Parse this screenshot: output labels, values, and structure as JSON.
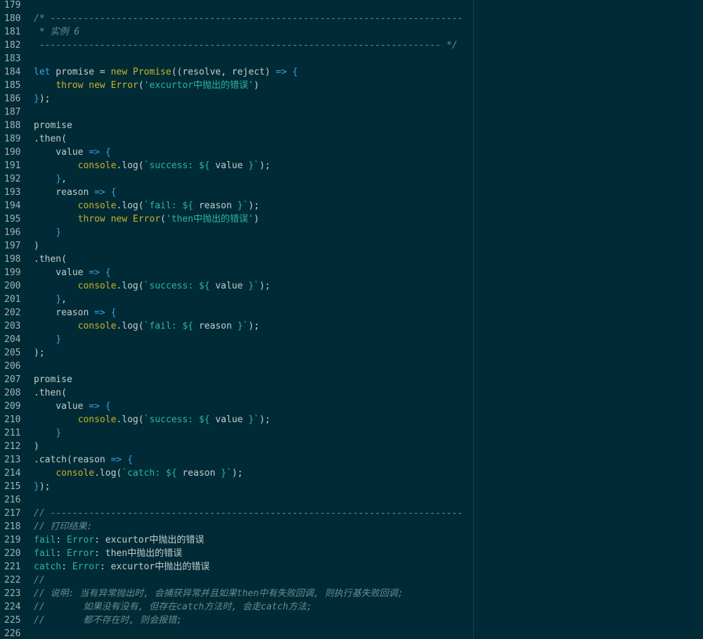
{
  "editor": {
    "theme": {
      "background": "#002b36",
      "line_number_color": "#a4b2b2",
      "text_color": "#c3cdcd",
      "keyword_color": "#3aa0e0",
      "function_color": "#c6b12e",
      "string_color": "#2eb3a5",
      "comment_color": "#6a8a91"
    },
    "lines": [
      {
        "n": "179",
        "tokens": []
      },
      {
        "n": "180",
        "tokens": [
          {
            "t": "/* ---------------------------------------------------------------------------",
            "c": "com"
          }
        ]
      },
      {
        "n": "181",
        "tokens": [
          {
            "t": " * 实例 6",
            "c": "com"
          }
        ]
      },
      {
        "n": "182",
        "tokens": [
          {
            "t": " ------------------------------------------------------------------------- */",
            "c": "com"
          }
        ]
      },
      {
        "n": "183",
        "tokens": []
      },
      {
        "n": "184",
        "tokens": [
          {
            "t": "let",
            "c": "kw"
          },
          {
            "t": " promise = ",
            "c": "text"
          },
          {
            "t": "new",
            "c": "kw2"
          },
          {
            "t": " ",
            "c": "text"
          },
          {
            "t": "Promise",
            "c": "cls"
          },
          {
            "t": "((resolve, reject) ",
            "c": "text"
          },
          {
            "t": "=>",
            "c": "op"
          },
          {
            "t": " ",
            "c": "text"
          },
          {
            "t": "{",
            "c": "pun"
          }
        ]
      },
      {
        "n": "185",
        "tokens": [
          {
            "t": "    ",
            "c": "text"
          },
          {
            "t": "throw",
            "c": "kw2"
          },
          {
            "t": " ",
            "c": "text"
          },
          {
            "t": "new",
            "c": "kw2"
          },
          {
            "t": " ",
            "c": "text"
          },
          {
            "t": "Error",
            "c": "cls"
          },
          {
            "t": "(",
            "c": "text"
          },
          {
            "t": "'excurtor中抛出的错误'",
            "c": "str"
          },
          {
            "t": ")",
            "c": "text"
          }
        ]
      },
      {
        "n": "186",
        "tokens": [
          {
            "t": "}",
            "c": "pun"
          },
          {
            "t": ");",
            "c": "text"
          }
        ]
      },
      {
        "n": "187",
        "tokens": []
      },
      {
        "n": "188",
        "tokens": [
          {
            "t": "promise",
            "c": "text"
          }
        ]
      },
      {
        "n": "189",
        "tokens": [
          {
            "t": ".then(",
            "c": "text"
          }
        ]
      },
      {
        "n": "190",
        "tokens": [
          {
            "t": "    value ",
            "c": "text"
          },
          {
            "t": "=>",
            "c": "op"
          },
          {
            "t": " ",
            "c": "text"
          },
          {
            "t": "{",
            "c": "pun"
          }
        ]
      },
      {
        "n": "191",
        "tokens": [
          {
            "t": "        ",
            "c": "text"
          },
          {
            "t": "console",
            "c": "fn"
          },
          {
            "t": ".log(",
            "c": "text"
          },
          {
            "t": "`success: ${",
            "c": "str"
          },
          {
            "t": " value ",
            "c": "text"
          },
          {
            "t": "}`",
            "c": "str"
          },
          {
            "t": ");",
            "c": "text"
          }
        ]
      },
      {
        "n": "192",
        "tokens": [
          {
            "t": "    ",
            "c": "text"
          },
          {
            "t": "}",
            "c": "pun"
          },
          {
            "t": ",",
            "c": "text"
          }
        ]
      },
      {
        "n": "193",
        "tokens": [
          {
            "t": "    reason ",
            "c": "text"
          },
          {
            "t": "=>",
            "c": "op"
          },
          {
            "t": " ",
            "c": "text"
          },
          {
            "t": "{",
            "c": "pun"
          }
        ]
      },
      {
        "n": "194",
        "tokens": [
          {
            "t": "        ",
            "c": "text"
          },
          {
            "t": "console",
            "c": "fn"
          },
          {
            "t": ".log(",
            "c": "text"
          },
          {
            "t": "`fail: ${",
            "c": "str"
          },
          {
            "t": " reason ",
            "c": "text"
          },
          {
            "t": "}`",
            "c": "str"
          },
          {
            "t": ");",
            "c": "text"
          }
        ]
      },
      {
        "n": "195",
        "tokens": [
          {
            "t": "        ",
            "c": "text"
          },
          {
            "t": "throw",
            "c": "kw2"
          },
          {
            "t": " ",
            "c": "text"
          },
          {
            "t": "new",
            "c": "kw2"
          },
          {
            "t": " ",
            "c": "text"
          },
          {
            "t": "Error",
            "c": "cls"
          },
          {
            "t": "(",
            "c": "text"
          },
          {
            "t": "'then中抛出的错误'",
            "c": "str"
          },
          {
            "t": ")",
            "c": "text"
          }
        ]
      },
      {
        "n": "196",
        "tokens": [
          {
            "t": "    ",
            "c": "text"
          },
          {
            "t": "}",
            "c": "pun"
          }
        ]
      },
      {
        "n": "197",
        "tokens": [
          {
            "t": ")",
            "c": "text"
          }
        ]
      },
      {
        "n": "198",
        "tokens": [
          {
            "t": ".then(",
            "c": "text"
          }
        ]
      },
      {
        "n": "199",
        "tokens": [
          {
            "t": "    value ",
            "c": "text"
          },
          {
            "t": "=>",
            "c": "op"
          },
          {
            "t": " ",
            "c": "text"
          },
          {
            "t": "{",
            "c": "pun"
          }
        ]
      },
      {
        "n": "200",
        "tokens": [
          {
            "t": "        ",
            "c": "text"
          },
          {
            "t": "console",
            "c": "fn"
          },
          {
            "t": ".log(",
            "c": "text"
          },
          {
            "t": "`success: ${",
            "c": "str"
          },
          {
            "t": " value ",
            "c": "text"
          },
          {
            "t": "}`",
            "c": "str"
          },
          {
            "t": ");",
            "c": "text"
          }
        ]
      },
      {
        "n": "201",
        "tokens": [
          {
            "t": "    ",
            "c": "text"
          },
          {
            "t": "}",
            "c": "pun"
          },
          {
            "t": ",",
            "c": "text"
          }
        ]
      },
      {
        "n": "202",
        "tokens": [
          {
            "t": "    reason ",
            "c": "text"
          },
          {
            "t": "=>",
            "c": "op"
          },
          {
            "t": " ",
            "c": "text"
          },
          {
            "t": "{",
            "c": "pun"
          }
        ]
      },
      {
        "n": "203",
        "tokens": [
          {
            "t": "        ",
            "c": "text"
          },
          {
            "t": "console",
            "c": "fn"
          },
          {
            "t": ".log(",
            "c": "text"
          },
          {
            "t": "`fail: ${",
            "c": "str"
          },
          {
            "t": " reason ",
            "c": "text"
          },
          {
            "t": "}`",
            "c": "str"
          },
          {
            "t": ");",
            "c": "text"
          }
        ]
      },
      {
        "n": "204",
        "tokens": [
          {
            "t": "    ",
            "c": "text"
          },
          {
            "t": "}",
            "c": "pun"
          }
        ]
      },
      {
        "n": "205",
        "tokens": [
          {
            "t": ");",
            "c": "text"
          }
        ]
      },
      {
        "n": "206",
        "tokens": []
      },
      {
        "n": "207",
        "tokens": [
          {
            "t": "promise",
            "c": "text"
          }
        ]
      },
      {
        "n": "208",
        "tokens": [
          {
            "t": ".then(",
            "c": "text"
          }
        ]
      },
      {
        "n": "209",
        "tokens": [
          {
            "t": "    value ",
            "c": "text"
          },
          {
            "t": "=>",
            "c": "op"
          },
          {
            "t": " ",
            "c": "text"
          },
          {
            "t": "{",
            "c": "pun"
          }
        ]
      },
      {
        "n": "210",
        "tokens": [
          {
            "t": "        ",
            "c": "text"
          },
          {
            "t": "console",
            "c": "fn"
          },
          {
            "t": ".log(",
            "c": "text"
          },
          {
            "t": "`success: ${",
            "c": "str"
          },
          {
            "t": " value ",
            "c": "text"
          },
          {
            "t": "}`",
            "c": "str"
          },
          {
            "t": ");",
            "c": "text"
          }
        ]
      },
      {
        "n": "211",
        "tokens": [
          {
            "t": "    ",
            "c": "text"
          },
          {
            "t": "}",
            "c": "pun"
          }
        ]
      },
      {
        "n": "212",
        "tokens": [
          {
            "t": ")",
            "c": "text"
          }
        ]
      },
      {
        "n": "213",
        "tokens": [
          {
            "t": ".catch(reason ",
            "c": "text"
          },
          {
            "t": "=>",
            "c": "op"
          },
          {
            "t": " ",
            "c": "text"
          },
          {
            "t": "{",
            "c": "pun"
          }
        ]
      },
      {
        "n": "214",
        "tokens": [
          {
            "t": "    ",
            "c": "text"
          },
          {
            "t": "console",
            "c": "fn"
          },
          {
            "t": ".log(",
            "c": "text"
          },
          {
            "t": "`catch: ${",
            "c": "str"
          },
          {
            "t": " reason ",
            "c": "text"
          },
          {
            "t": "}`",
            "c": "str"
          },
          {
            "t": ");",
            "c": "text"
          }
        ]
      },
      {
        "n": "215",
        "tokens": [
          {
            "t": "}",
            "c": "pun"
          },
          {
            "t": ");",
            "c": "text"
          }
        ]
      },
      {
        "n": "216",
        "tokens": []
      },
      {
        "n": "217",
        "tokens": [
          {
            "t": "// ---------------------------------------------------------------------------",
            "c": "com"
          }
        ]
      },
      {
        "n": "218",
        "tokens": [
          {
            "t": "// 打印结果:",
            "c": "com"
          }
        ]
      },
      {
        "n": "219",
        "tokens": [
          {
            "t": "fail",
            "c": "err"
          },
          {
            "t": ": ",
            "c": "text"
          },
          {
            "t": "Error",
            "c": "err"
          },
          {
            "t": ": excurtor中抛出的错误",
            "c": "text"
          }
        ]
      },
      {
        "n": "220",
        "tokens": [
          {
            "t": "fail",
            "c": "err"
          },
          {
            "t": ": ",
            "c": "text"
          },
          {
            "t": "Error",
            "c": "err"
          },
          {
            "t": ": then中抛出的错误",
            "c": "text"
          }
        ]
      },
      {
        "n": "221",
        "tokens": [
          {
            "t": "catch",
            "c": "err"
          },
          {
            "t": ": ",
            "c": "text"
          },
          {
            "t": "Error",
            "c": "err"
          },
          {
            "t": ": excurtor中抛出的错误",
            "c": "text"
          }
        ]
      },
      {
        "n": "222",
        "tokens": [
          {
            "t": "//",
            "c": "com"
          }
        ]
      },
      {
        "n": "223",
        "tokens": [
          {
            "t": "// 说明: 当有异常抛出时, 会捕获异常并且如果then中有失败回调, 则执行基失败回调;",
            "c": "com"
          }
        ]
      },
      {
        "n": "224",
        "tokens": [
          {
            "t": "//       如果没有没有, 但存在catch方法时, 会走catch方法;",
            "c": "com"
          }
        ]
      },
      {
        "n": "225",
        "tokens": [
          {
            "t": "//       都不存在时, 则会报错;",
            "c": "com"
          }
        ]
      },
      {
        "n": "226",
        "tokens": []
      }
    ]
  }
}
